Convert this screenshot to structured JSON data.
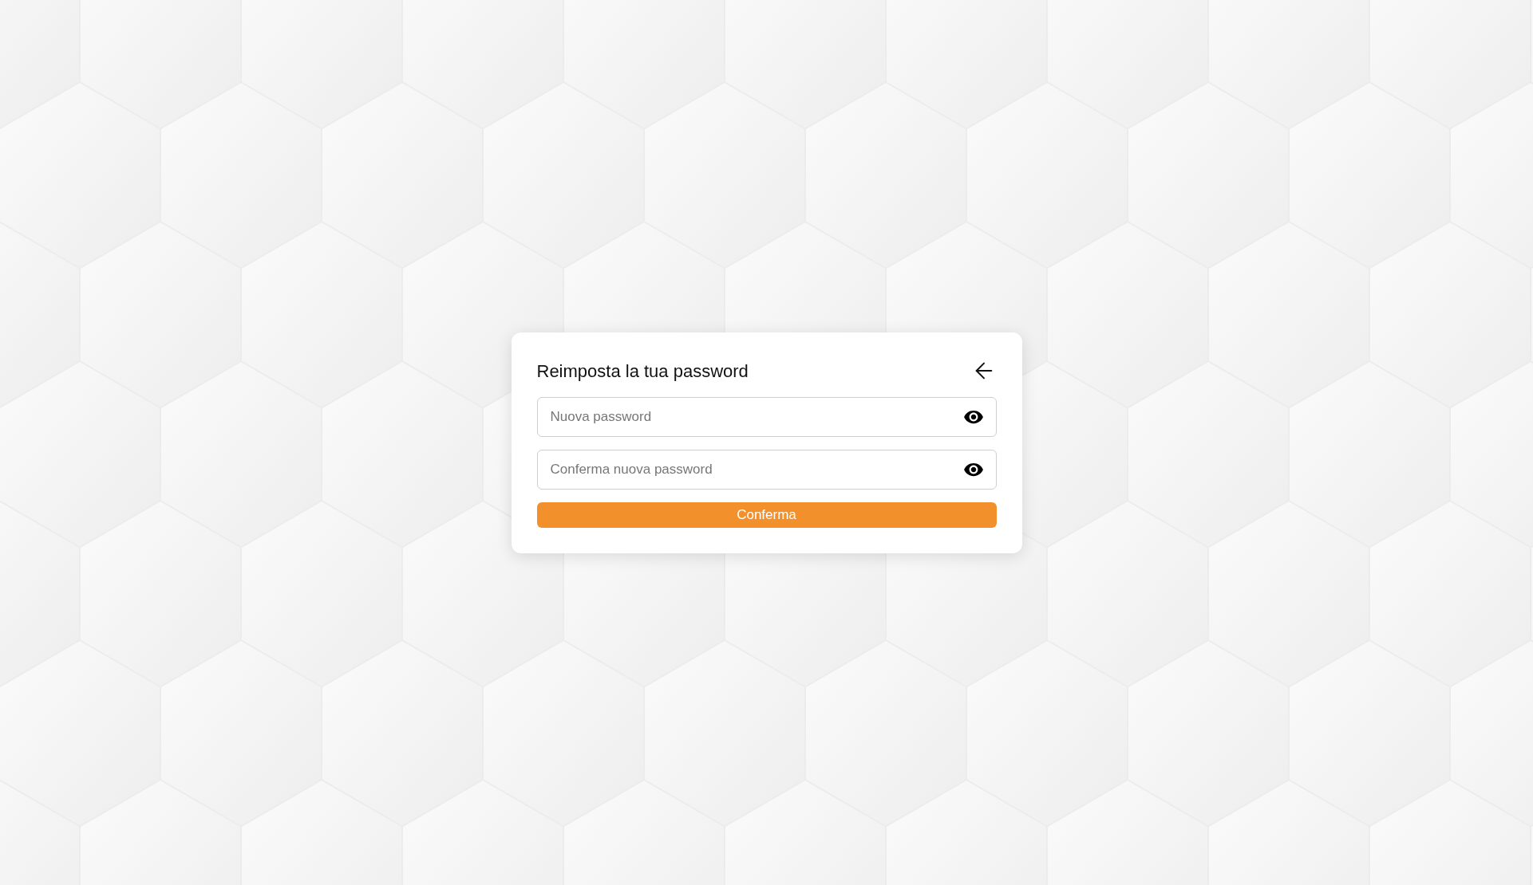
{
  "dialog": {
    "title": "Reimposta la tua password"
  },
  "fields": [
    {
      "placeholder": "Nuova password"
    },
    {
      "placeholder": "Conferma nuova password"
    }
  ],
  "submit_button": {
    "label": "Conferma"
  }
}
